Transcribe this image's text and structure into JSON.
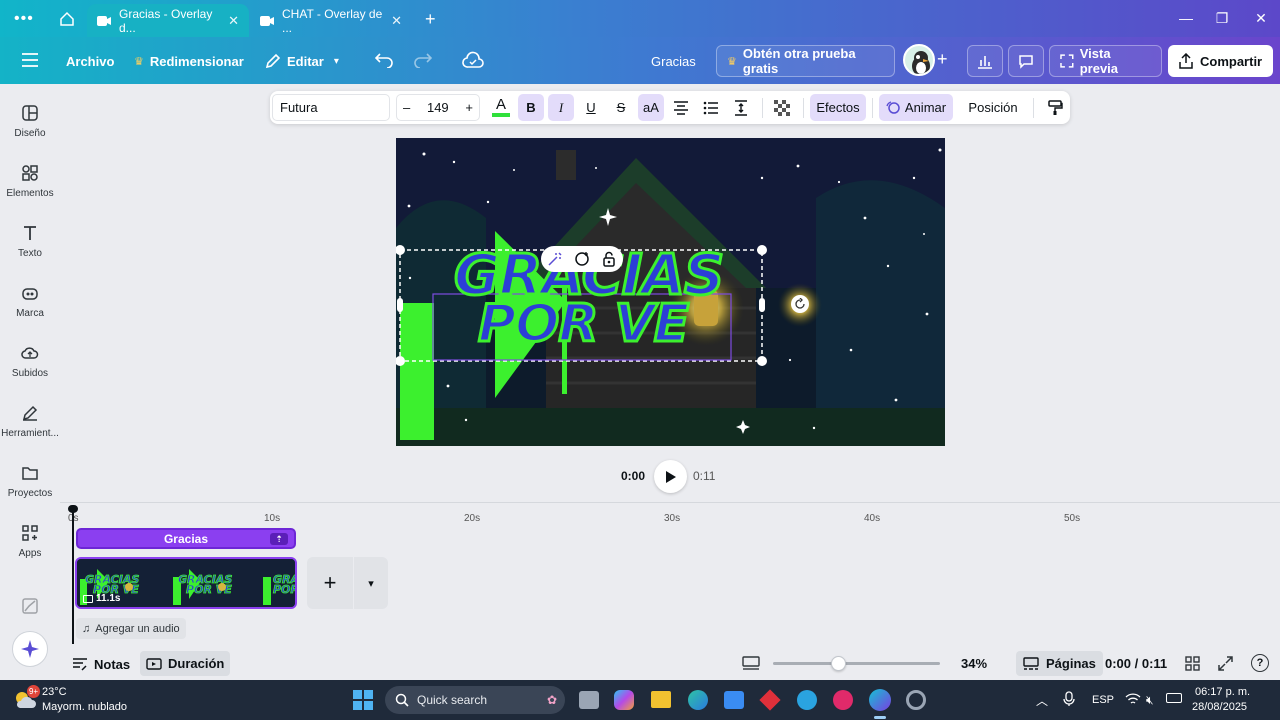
{
  "browser": {
    "tabs": [
      {
        "title": "Gracias - Overlay d...",
        "active": true
      },
      {
        "title": "CHAT - Overlay de ...",
        "active": false
      }
    ],
    "new_tab": "+"
  },
  "header": {
    "file": "Archivo",
    "resize": "Redimensionar",
    "edit": "Editar",
    "doc_title": "Gracias",
    "trial": "Obtén otra prueba gratis",
    "preview": "Vista previa",
    "share": "Compartir"
  },
  "sidebar": {
    "items": [
      {
        "label": "Diseño",
        "icon": "layout-icon"
      },
      {
        "label": "Elementos",
        "icon": "shapes-icon"
      },
      {
        "label": "Texto",
        "icon": "text-icon"
      },
      {
        "label": "Marca",
        "icon": "brand-icon"
      },
      {
        "label": "Subidos",
        "icon": "cloud-upload-icon"
      },
      {
        "label": "Herramient...",
        "icon": "tools-icon"
      },
      {
        "label": "Proyectos",
        "icon": "folder-icon"
      },
      {
        "label": "Apps",
        "icon": "apps-icon"
      }
    ]
  },
  "toolbar": {
    "font": "Futura",
    "minus": "–",
    "size": "149",
    "plus": "+",
    "case": "aA",
    "effects": "Efectos",
    "animate": "Animar",
    "position": "Posición"
  },
  "canvas": {
    "line1": "GRACIAS",
    "line2": "POR VE"
  },
  "playback": {
    "current": "0:00",
    "total": "0:11"
  },
  "timeline": {
    "ticks": [
      "0s",
      "10s",
      "20s",
      "30s",
      "40s",
      "50s"
    ],
    "text_track": "Gracias",
    "clip_duration": "11.1s",
    "add_audio": "Agregar un audio",
    "add": "+"
  },
  "footer": {
    "notes": "Notas",
    "duration": "Duración",
    "zoom": "34%",
    "zoom_level": 0.34,
    "pages": "Páginas",
    "time": "0:00 / 0:11",
    "help": "?"
  },
  "taskbar": {
    "temp": "23°C",
    "weather": "Mayorm. nublado",
    "search": "Quick search",
    "lang": "ESP",
    "clock": "06:17 p. m.",
    "date": "28/08/2025"
  }
}
